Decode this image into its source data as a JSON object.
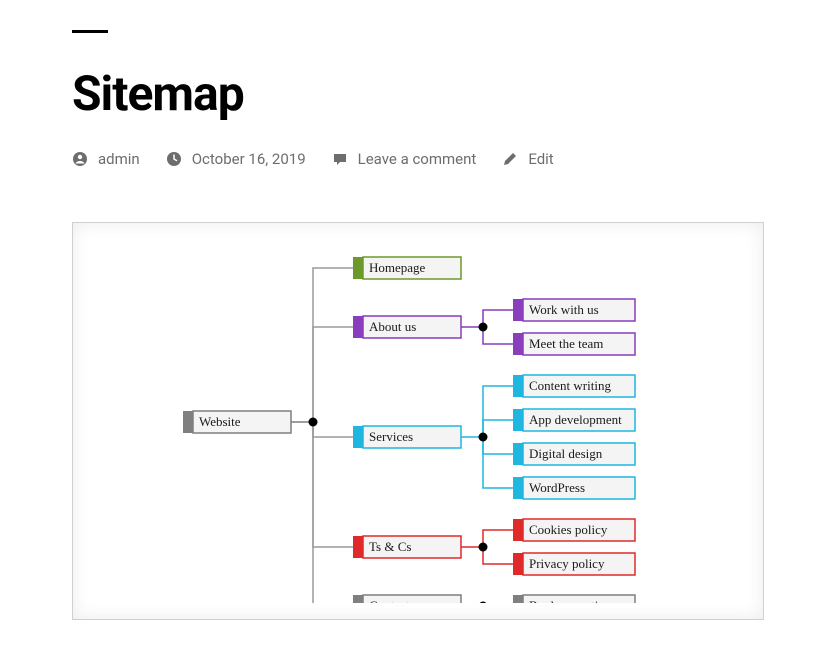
{
  "page": {
    "title": "Sitemap"
  },
  "meta": {
    "author": "admin",
    "date": "October 16, 2019",
    "comments_label": "Leave a comment",
    "edit_label": "Edit"
  },
  "diagram": {
    "root": {
      "label": "Website",
      "color": "#7f7f7f"
    },
    "branches": [
      {
        "label": "Homepage",
        "color": "#6b9a2a",
        "children": []
      },
      {
        "label": "About us",
        "color": "#8a3dbd",
        "children": [
          {
            "label": "Work with us"
          },
          {
            "label": "Meet the team"
          }
        ]
      },
      {
        "label": "Services",
        "color": "#1fb6e0",
        "children": [
          {
            "label": "Content writing"
          },
          {
            "label": "App development"
          },
          {
            "label": "Digital design"
          },
          {
            "label": "WordPress"
          }
        ]
      },
      {
        "label": "Ts & Cs",
        "color": "#e02a2a",
        "children": [
          {
            "label": "Cookies policy"
          },
          {
            "label": "Privacy policy"
          }
        ]
      },
      {
        "label": "Contact us",
        "color": "#7f7f7f",
        "children": [
          {
            "label": "Book a meeting"
          }
        ]
      }
    ]
  }
}
